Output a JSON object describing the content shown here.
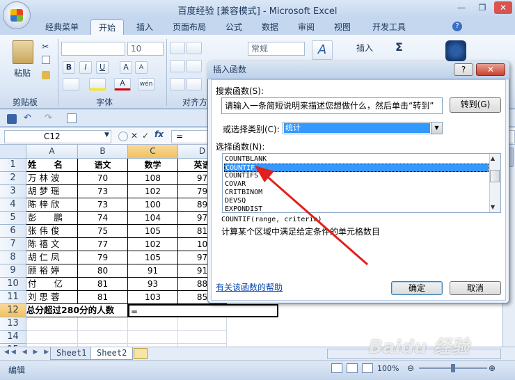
{
  "window": {
    "title": "百度经验  [兼容模式] - Microsoft Excel"
  },
  "tabs": [
    "经典菜单",
    "开始",
    "插入",
    "页面布局",
    "公式",
    "数据",
    "审阅",
    "视图",
    "开发工具"
  ],
  "ribbon": {
    "clipboard_label": "剪贴板",
    "paste_label": "粘贴",
    "font_label": "字体",
    "align_label": "对齐方",
    "font_size": "10",
    "number_format": "常规",
    "insert_label": "插入",
    "sigma": "Σ",
    "bold": "B",
    "italic": "I",
    "underline": "U",
    "grow_font": "A",
    "shrink_font": "A",
    "font_color": "A",
    "phonetic": "wén"
  },
  "formula_bar": {
    "name_box": "C12",
    "fx": "fx",
    "equals": "=",
    "cancel": "✕",
    "enter": "✓"
  },
  "sheet": {
    "columns": [
      "A",
      "B",
      "C",
      "D"
    ],
    "header_row": [
      "姓　　名",
      "语文",
      "数学",
      "英语"
    ],
    "rows": [
      {
        "row": "2",
        "name": "万 林 波",
        "chinese": "70",
        "math": "108",
        "eng": "97"
      },
      {
        "row": "3",
        "name": "胡 梦 瑶",
        "chinese": "73",
        "math": "102",
        "eng": "79"
      },
      {
        "row": "4",
        "name": "陈 梓 欣",
        "chinese": "73",
        "math": "100",
        "eng": "89"
      },
      {
        "row": "5",
        "name": "彭　　鹏",
        "chinese": "74",
        "math": "104",
        "eng": "97"
      },
      {
        "row": "6",
        "name": "张 伟 俊",
        "chinese": "75",
        "math": "105",
        "eng": "81"
      },
      {
        "row": "7",
        "name": "陈 禧 文",
        "chinese": "77",
        "math": "102",
        "eng": "10"
      },
      {
        "row": "8",
        "name": "胡 仁 凤",
        "chinese": "79",
        "math": "105",
        "eng": "97"
      },
      {
        "row": "9",
        "name": "顾 裕 婷",
        "chinese": "80",
        "math": "91",
        "eng": "91"
      },
      {
        "row": "10",
        "name": "付　　亿",
        "chinese": "81",
        "math": "93",
        "eng": "88"
      },
      {
        "row": "11",
        "name": "刘 思 蓉",
        "chinese": "81",
        "math": "103",
        "eng": "85"
      }
    ],
    "row_numbers": [
      "1",
      "2",
      "3",
      "4",
      "5",
      "6",
      "7",
      "8",
      "9",
      "10",
      "11",
      "12",
      "13",
      "14",
      "15"
    ],
    "summary_label": "总分超过280分的人数",
    "summary_value": "="
  },
  "sheet_tabs": [
    "Sheet1",
    "Sheet2"
  ],
  "status": {
    "mode": "编辑",
    "zoom": "100%"
  },
  "dialog": {
    "title": "插入函数",
    "search_label": "搜索函数(S):",
    "search_value": "请输入一条简短说明来描述您想做什么，然后单击“转到”",
    "goto_button": "转到(G)",
    "category_label": "或选择类别(C):",
    "category_value": "统计",
    "select_label": "选择函数(N):",
    "functions": [
      "COUNTBLANK",
      "COUNTIF",
      "COUNTIFS",
      "COVAR",
      "CRITBINOM",
      "DEVSQ",
      "EXPONDIST"
    ],
    "selected_function": "COUNTIF",
    "syntax": "COUNTIF(range, criteria)",
    "description": "计算某个区域中满足给定条件的单元格数目",
    "help_link": "有关该函数的帮助",
    "ok": "确定",
    "cancel": "取消",
    "help_btn": "?",
    "close_btn": "✕"
  },
  "watermark": "Baidu 经验",
  "colors": {
    "accent": "#3399ff",
    "arrow": "#e0201c",
    "selected_header": "#f1c15f"
  }
}
